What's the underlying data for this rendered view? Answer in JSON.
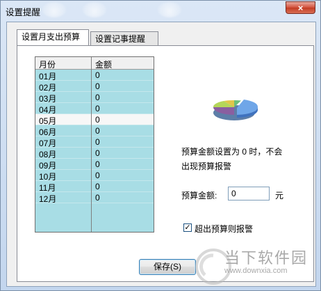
{
  "window": {
    "title": "设置提醒",
    "close_glyph": "×"
  },
  "tabs": [
    {
      "label": "设置月支出预算",
      "active": true
    },
    {
      "label": "设置记事提醒",
      "active": false
    }
  ],
  "grid": {
    "headers": [
      "月份",
      "金额"
    ],
    "rows": [
      {
        "month": "01月",
        "amount": "0"
      },
      {
        "month": "02月",
        "amount": "0"
      },
      {
        "month": "03月",
        "amount": "0"
      },
      {
        "month": "04月",
        "amount": "0"
      },
      {
        "month": "05月",
        "amount": "0"
      },
      {
        "month": "06月",
        "amount": "0"
      },
      {
        "month": "07月",
        "amount": "0"
      },
      {
        "month": "08月",
        "amount": "0"
      },
      {
        "month": "09月",
        "amount": "0"
      },
      {
        "month": "10月",
        "amount": "0"
      },
      {
        "month": "11月",
        "amount": "0"
      },
      {
        "month": "12月",
        "amount": "0"
      }
    ],
    "selected_row": 4
  },
  "info": {
    "line1": "预算金额设置为 0 时，不会",
    "line2": "出现预算报警"
  },
  "budget": {
    "label": "预算金额:",
    "value": "0",
    "unit": "元"
  },
  "alarm": {
    "label": "超出预算则报警",
    "checked": true,
    "check_glyph": "✓"
  },
  "save_button": {
    "label": "保存(S)"
  },
  "icons": {
    "pie": "pie-chart-icon"
  },
  "watermark": {
    "text": "当下软件园",
    "url": "www.downxia.com"
  },
  "colors": {
    "grid_row": "#a8dde5",
    "selected_row": "#f7f7f7",
    "close_button": "#c94a33"
  }
}
